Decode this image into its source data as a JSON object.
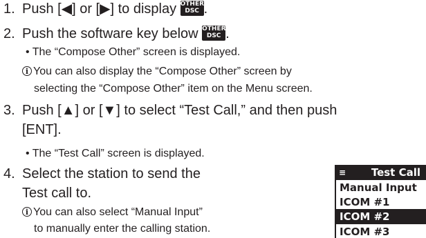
{
  "steps": [
    {
      "num": "1.",
      "pre": "Push [◀] or [▶] to display ",
      "post": "."
    },
    {
      "num": "2.",
      "pre": "Push the software key below ",
      "post": "."
    },
    {
      "num": "3.",
      "line1": "Push [▲] or [▼] to select “Test Call,” and then push",
      "line2": "[ENT]."
    },
    {
      "num": "4.",
      "line1": "Select the station to send the",
      "line2": "Test call to."
    }
  ],
  "softkey": {
    "top": "OTHER",
    "bottom": "DSC"
  },
  "info_icon": "i",
  "step2_bullet": "• The “Compose Other” screen is displayed.",
  "step2_info_line1": "You can also display the “Compose Other” screen by",
  "step2_info_line2": "selecting the “Compose Other” item on the Menu screen.",
  "step3_bullet": "• The “Test Call” screen is displayed.",
  "step4_info_line1": "You can also select “Manual Input”",
  "step4_info_line2": "to manually enter the calling station.",
  "lcd": {
    "menu_icon": "≡",
    "title": "Test Call",
    "items": [
      "Manual Input",
      "ICOM #1",
      "ICOM #2",
      "ICOM #3"
    ],
    "selected_index": 2
  }
}
